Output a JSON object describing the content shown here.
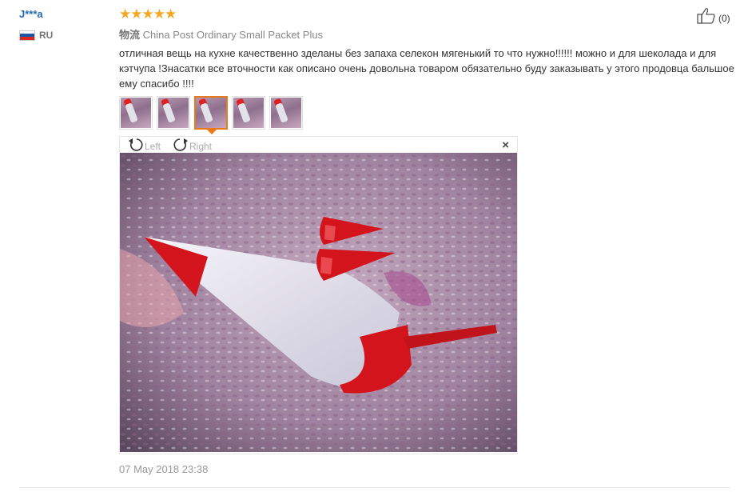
{
  "reviewer": {
    "name": "J***a",
    "country_code": "RU",
    "flag_colors": [
      "#ffffff",
      "#1c57a5",
      "#d52b1e"
    ]
  },
  "rating": {
    "stars": 5,
    "glyphs": "★★★★★",
    "color": "#f5a623"
  },
  "helpful": {
    "count_label": "(0)",
    "icon": "thumbs-up-icon"
  },
  "shipping": {
    "label": "物流",
    "method": "China Post Ordinary Small Packet Plus"
  },
  "review": {
    "text": "отличная вещь на кухне качественно зделаны без запаха селекон мягенький то что нужно!!!!!! можно и для шеколада и для кэтчупа !Знасатки все вточности как описано очень довольна товаром обязательно буду заказывать у этого продовца бальшое ему спасибо !!!!"
  },
  "thumbnails": {
    "count": 5,
    "active_index": 2
  },
  "viewer": {
    "rotate_left_label": "Left",
    "rotate_right_label": "Right",
    "close_label": "×"
  },
  "date": "07 May 2018 23:38",
  "colors": {
    "username": "#2468b3",
    "active_thumb": "#e87a1a",
    "product_red": "#d3141c"
  }
}
